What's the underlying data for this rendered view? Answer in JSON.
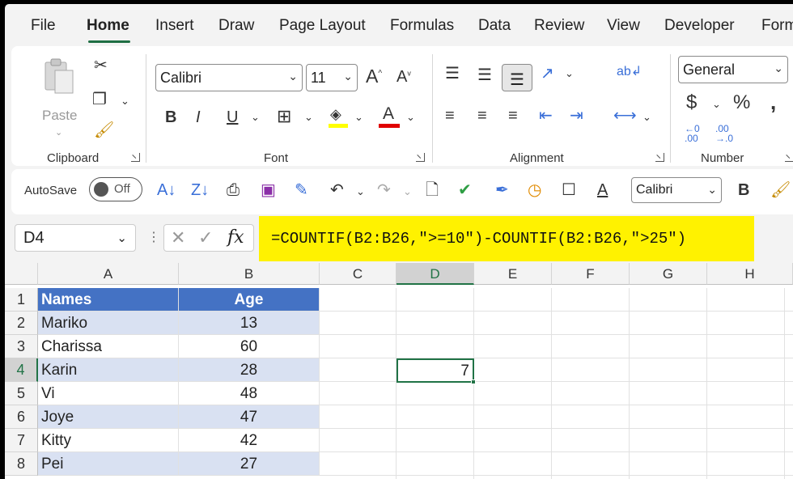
{
  "tabs": [
    "File",
    "Home",
    "Insert",
    "Draw",
    "Page Layout",
    "Formulas",
    "Data",
    "Review",
    "View",
    "Developer",
    "Form"
  ],
  "active_tab": "Home",
  "clipboard": {
    "paste_label": "Paste",
    "group_label": "Clipboard"
  },
  "font": {
    "name": "Calibri",
    "size": "11",
    "group_label": "Font"
  },
  "alignment": {
    "group_label": "Alignment"
  },
  "number": {
    "format": "General",
    "group_label": "Number"
  },
  "qat": {
    "autosave_label": "AutoSave",
    "toggle_state": "Off",
    "font_name": "Calibri"
  },
  "formula_bar": {
    "name_box": "D4",
    "formula": "=COUNTIF(B2:B26,\">=10\")-COUNTIF(B2:B26,\">25\")"
  },
  "grid": {
    "columns": [
      "A",
      "B",
      "C",
      "D",
      "E",
      "F",
      "G",
      "H"
    ],
    "rows": [
      "1",
      "2",
      "3",
      "4",
      "5",
      "6",
      "7",
      "8"
    ],
    "header": {
      "names": "Names",
      "age": "Age"
    },
    "data": [
      {
        "name": "Mariko",
        "age": "13"
      },
      {
        "name": "Charissa",
        "age": "60"
      },
      {
        "name": "Karin",
        "age": "28"
      },
      {
        "name": "Vi",
        "age": "48"
      },
      {
        "name": "Joye",
        "age": "47"
      },
      {
        "name": "Kitty",
        "age": "42"
      },
      {
        "name": "Pei",
        "age": "27"
      }
    ],
    "selected_cell_value": "7"
  },
  "colors": {
    "accent": "#217346",
    "table_header": "#4472c4",
    "band": "#d9e1f2",
    "highlight": "#fff200"
  }
}
